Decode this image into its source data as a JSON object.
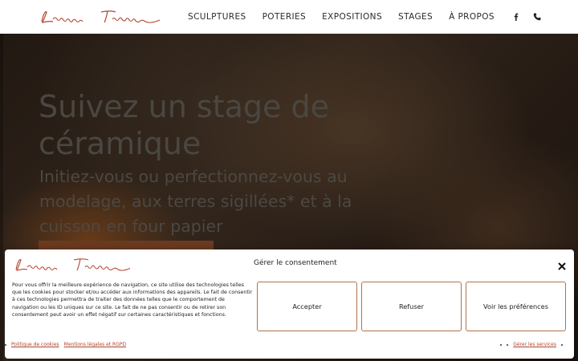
{
  "header": {
    "logo_alt": "Lauriane Firoben",
    "nav": [
      "SCULPTURES",
      "POTERIES",
      "EXPOSITIONS",
      "STAGES",
      "À PROPOS"
    ],
    "icons": [
      "facebook-icon",
      "phone-icon"
    ]
  },
  "hero": {
    "title": "Suivez un stage de céramique",
    "subtitle": "Initiez-vous ou perfectionnez-vous au modelage, aux terres sigillées* et à la cuisson en four papier"
  },
  "consent": {
    "title": "Gérer le consentement",
    "text": "Pour vous offrir la meilleure expérience de navigation, ce site utilise des technologies telles que les cookies pour stocker et/ou accéder aux informations des appareils. Le fait de consentir à ces technologies permettra de traiter des données telles que le comportement de navigation ou les ID uniques sur ce site. Le fait de ne pas consentir ou de retirer son consentement peut avoir un effet négatif sur certaines caractéristiques et fonctions.",
    "accept": "Accepter",
    "refuse": "Refuser",
    "prefs": "Voir les préférences",
    "link_cookies": "Politique de cookies",
    "link_legal": "Mentions légales et RGPD",
    "link_services": "Gérer les services"
  },
  "colors": {
    "accent": "#b0432a",
    "button_border": "#b0724a"
  }
}
